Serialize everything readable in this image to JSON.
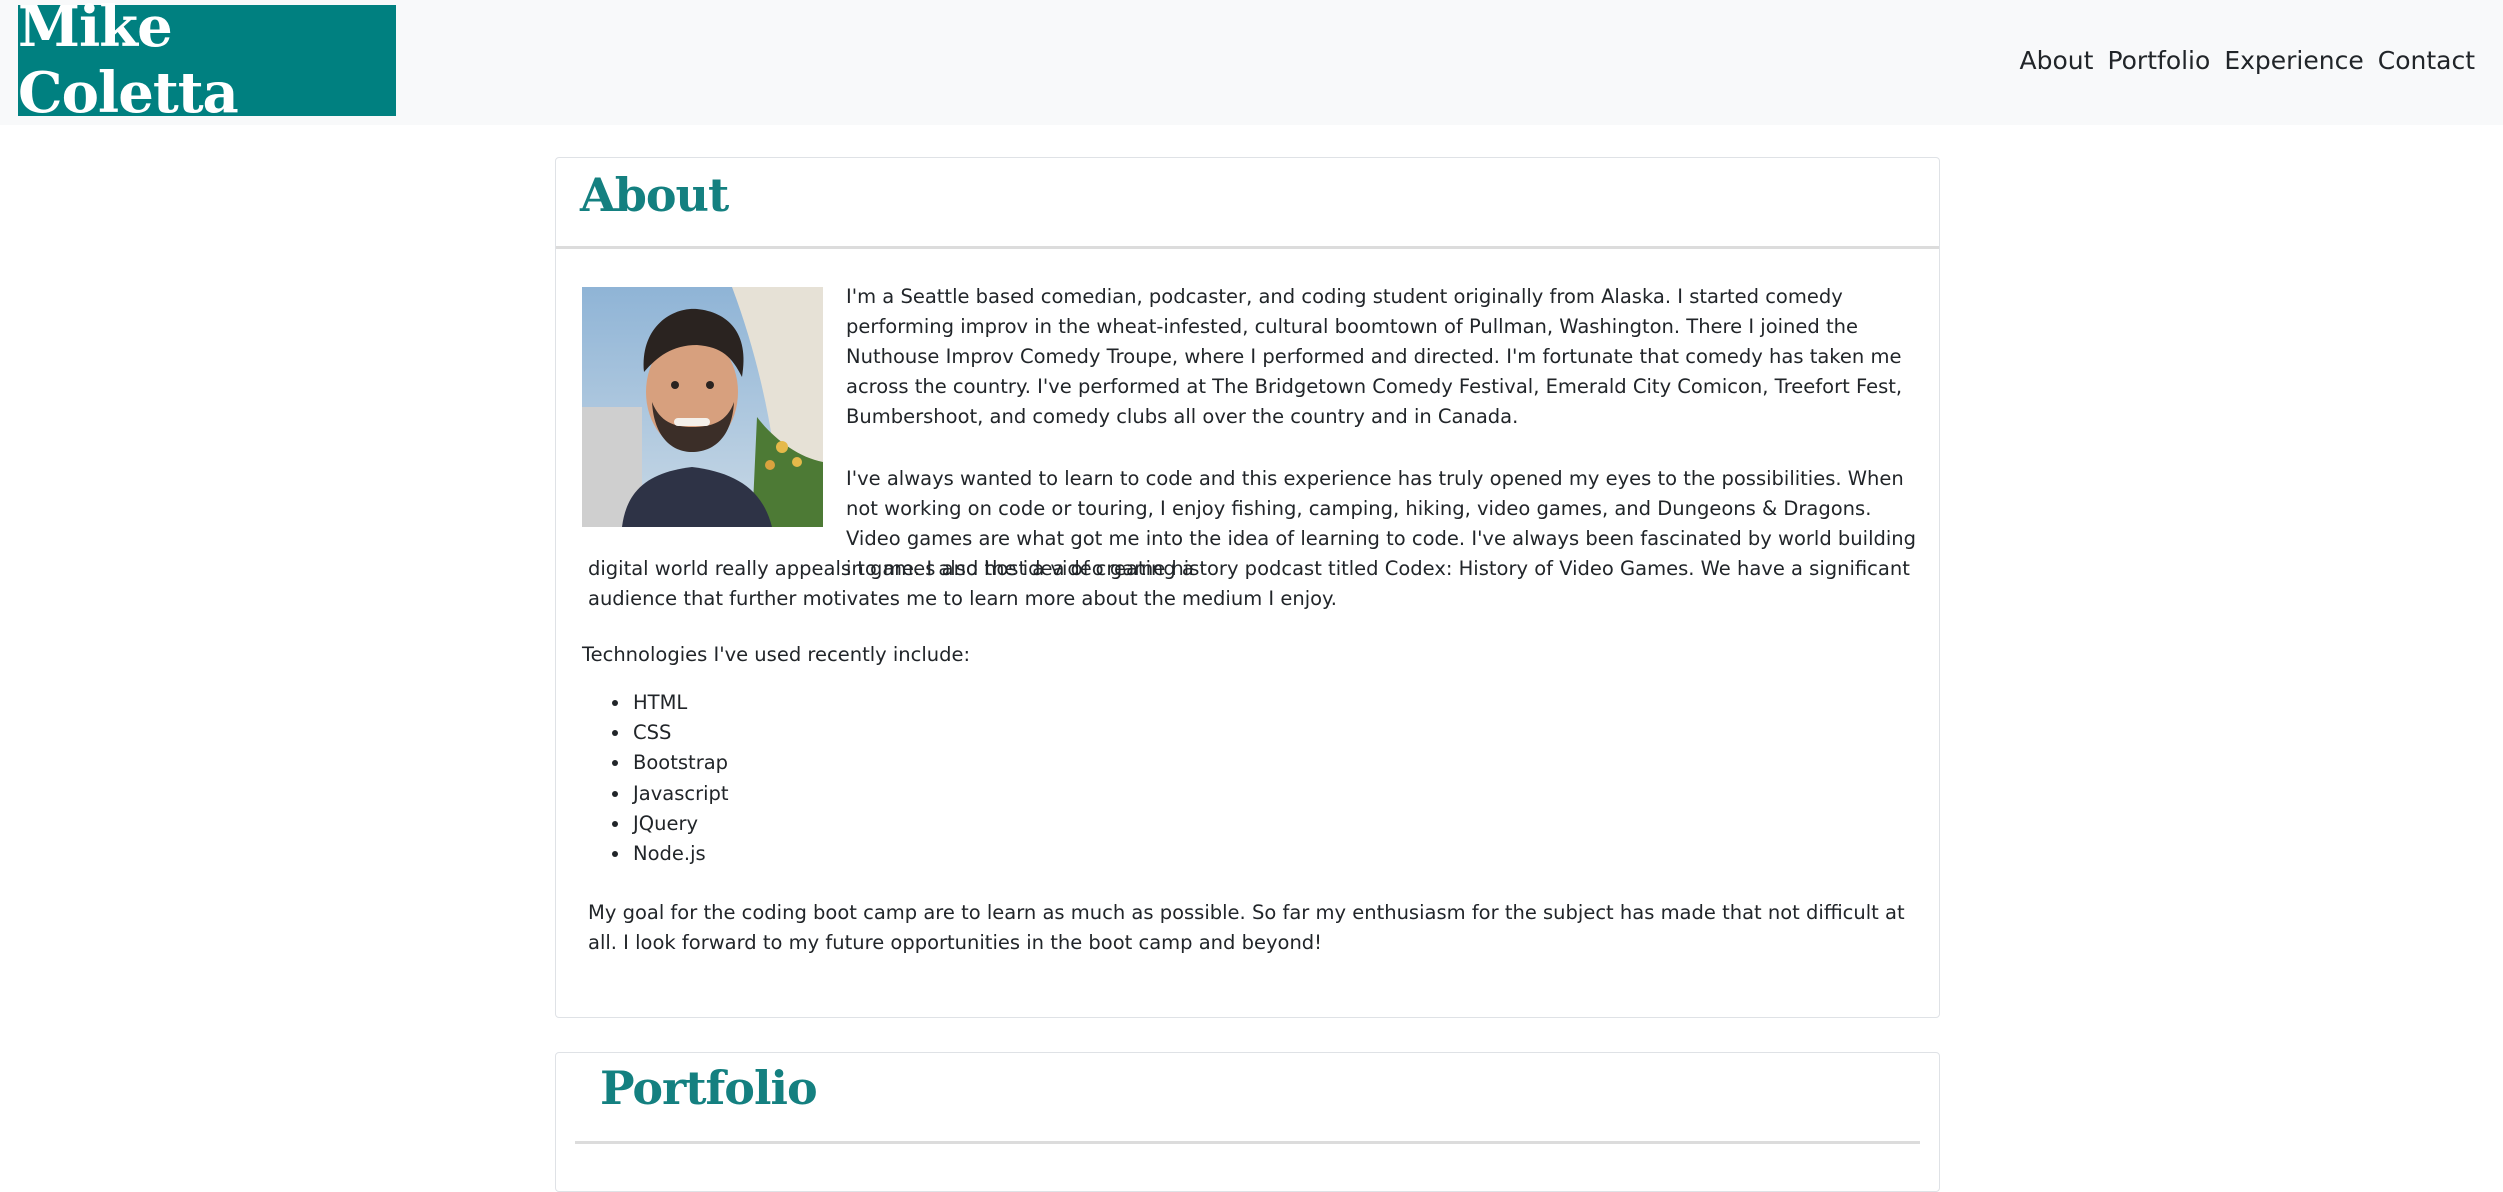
{
  "header": {
    "brand": "Mike Coletta",
    "nav": [
      "About",
      "Portfolio",
      "Experience",
      "Contact"
    ]
  },
  "about": {
    "title": "About",
    "paragraph1": "I'm a Seattle based comedian, podcaster, and coding student originally from Alaska. I started comedy performing improv in the wheat-infested, cultural boomtown of Pullman, Washington. There I joined the Nuthouse Improv Comedy Troupe, where I performed and directed. I'm fortunate that comedy has taken me across the country. I've performed at The Bridgetown Comedy Festival, Emerald City Comicon, Treefort Fest, Bumbershoot, and comedy clubs all over the country and in Canada.",
    "paragraph2a": "I've always wanted to learn to code and this experience has truly opened my eyes to the possibilities. When not working on code or touring, I enjoy fishing, camping, hiking, video games, and Dungeons & Dragons. Video games are what got me into the idea of learning to code. I've always been fascinated by world building in games and the idea of creating a",
    "paragraph2b": "digital world really appeals to me. I also host a video game history podcast titled Codex: History of Video Games. We have a significant audience that further motivates me to learn more about the medium I enjoy.",
    "tech_intro": "Technologies I've used recently include:",
    "technologies": [
      "HTML",
      "CSS",
      "Bootstrap",
      "Javascript",
      "JQuery",
      "Node.js"
    ],
    "paragraph_goal": "My goal for the coding boot camp are to learn as much as possible. So far my enthusiasm for the subject has made that not difficult at all. I look forward to my future opportunities in the boot camp and beyond!"
  },
  "portfolio": {
    "title": "Portfolio"
  },
  "colors": {
    "brand_bg": "#008080",
    "heading": "#148080",
    "navbar_bg": "#f8f9fa"
  }
}
